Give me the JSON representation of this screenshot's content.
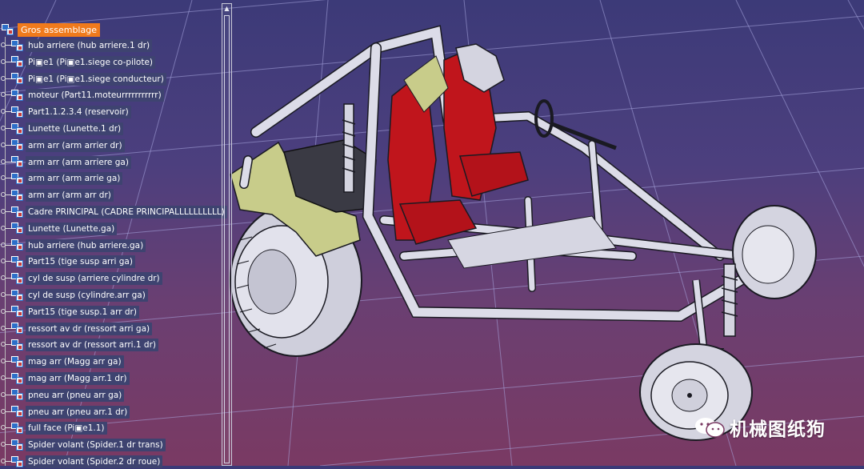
{
  "tree": {
    "root_label": "Gros assemblage",
    "items": [
      "hub arriere (hub arriere.1  dr)",
      "Pi▣e1 (Pi▣e1.siege co-pilote)",
      "Pi▣e1 (Pi▣e1.siege conducteur)",
      "moteur (Part11.moteurrrrrrrrrrr)",
      "Part1.1.2.3.4 (reservoir)",
      "Lunette (Lunette.1 dr)",
      "arm arr (arm arrier  dr)",
      "arm arr (arm arriere ga)",
      "arm arr (arm arrie ga)",
      "arm arr (arm arr  dr)",
      "Cadre PRINCIPAL (CADRE PRINCIPALLLLLLLLLL)",
      "Lunette (Lunette.ga)",
      "hub arriere (hub arriere.ga)",
      "Part15 (tige susp arri ga)",
      "cyl de susp (arriere cylindre  dr)",
      "cyl de susp (cylindre.arr ga)",
      "Part15 (tige susp.1 arr dr)",
      "ressort av dr (ressort arri ga)",
      "ressort av dr (ressort arri.1  dr)",
      "mag arr (Magg arr ga)",
      "mag arr (Magg arr.1  dr)",
      "pneu arr (pneu arr ga)",
      "pneu arr (pneu arr.1  dr)",
      "full face (Pi▣e1.1)",
      "Spider volant (Spider.1 dr trans)",
      "Spider volant (Spider.2 dr roue)"
    ]
  },
  "watermark": {
    "text": "机械图纸狗"
  },
  "colors": {
    "selection": "#f07a1c",
    "label_bg": "#3e4370",
    "frame": "#d9d9e6",
    "seat": "#c0151c",
    "fender": "#c8cc8a",
    "tire": "#d4d4e0"
  }
}
